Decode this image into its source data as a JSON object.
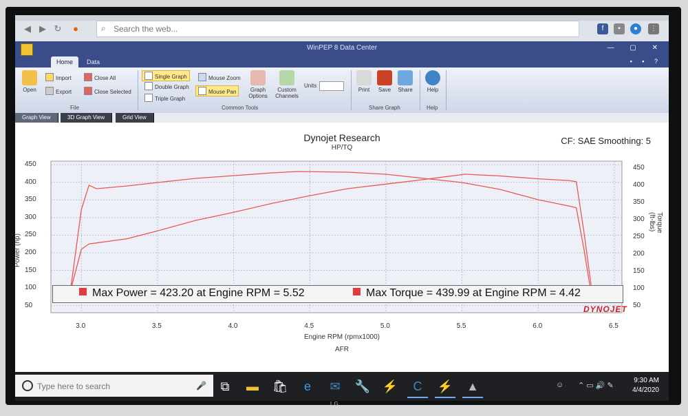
{
  "browser": {
    "search_placeholder": "Search the web..."
  },
  "app": {
    "title": "WinPEP 8 Data Center",
    "tabs": [
      "Home",
      "Data"
    ]
  },
  "ribbon": {
    "open": "Open",
    "import": "Import",
    "export": "Export",
    "close_all": "Close All",
    "close_selected": "Close Selected",
    "file_group": "File",
    "single_graph": "Single Graph",
    "double_graph": "Double Graph",
    "triple_graph": "Triple Graph",
    "mouse_zoom": "Mouse Zoom",
    "mouse_pan": "Mouse Pan",
    "graph_options_1": "Graph",
    "graph_options_2": "Options",
    "custom_channels_1": "Custom",
    "custom_channels_2": "Channels",
    "units": "Units",
    "common_tools_group": "Common Tools",
    "print": "Print",
    "save": "Save",
    "share": "Share",
    "share_graph_group": "Share Graph",
    "help": "Help",
    "help_group": "Help"
  },
  "view_tabs": [
    "Graph View",
    "3D Graph View",
    "Grid View"
  ],
  "graph": {
    "title": "Dynojet Research",
    "subtitle": "HP/TQ",
    "cf": "CF: SAE Smoothing: 5",
    "ylabel_left": "Power (hp)",
    "ylabel_right": "Torque (ft-lbs)",
    "xlabel": "Engine RPM (rpmx1000)",
    "footer": "AFR",
    "brand": "DYNOJET",
    "legend": [
      "Max Power = 423.20 at Engine RPM = 5.52",
      "Max Torque = 439.99 at Engine RPM = 4.42"
    ],
    "left_ticks": [
      "450",
      "400",
      "350",
      "300",
      "250",
      "200",
      "150",
      "100",
      "50"
    ],
    "right_ticks": [
      "450",
      "400",
      "350",
      "300",
      "250",
      "200",
      "150",
      "100",
      "50"
    ],
    "x_ticks": [
      "3.0",
      "3.5",
      "4.0",
      "4.5",
      "5.0",
      "5.5",
      "6.0",
      "6.5"
    ]
  },
  "chart_data": {
    "type": "line",
    "title": "Dynojet Research",
    "subtitle": "HP/TQ",
    "xlabel": "Engine RPM (rpmx1000)",
    "ylabel": "Power (hp)",
    "ylabel_right": "Torque (ft-lbs)",
    "xlim": [
      2.8,
      6.55
    ],
    "ylim": [
      30,
      460
    ],
    "ylim_right": [
      30,
      470
    ],
    "grid": true,
    "color": "#e8584f",
    "series": [
      {
        "name": "Power",
        "axis": "left",
        "x": [
          2.93,
          3.0,
          3.05,
          3.1,
          3.3,
          3.5,
          3.75,
          4.0,
          4.25,
          4.5,
          4.75,
          5.0,
          5.25,
          5.52,
          5.75,
          6.0,
          6.2,
          6.25,
          6.3,
          6.35
        ],
        "values": [
          95,
          210,
          225,
          228,
          240,
          262,
          292,
          315,
          340,
          362,
          382,
          395,
          408,
          423,
          418,
          410,
          405,
          402,
          260,
          100
        ]
      },
      {
        "name": "Torque",
        "axis": "right",
        "x": [
          2.93,
          3.0,
          3.05,
          3.1,
          3.3,
          3.5,
          3.75,
          4.0,
          4.25,
          4.42,
          4.75,
          5.0,
          5.25,
          5.5,
          5.75,
          6.0,
          6.2,
          6.25,
          6.3,
          6.35
        ],
        "values": [
          100,
          330,
          400,
          390,
          398,
          408,
          420,
          428,
          436,
          440,
          438,
          432,
          420,
          408,
          388,
          358,
          340,
          335,
          215,
          80
        ]
      }
    ]
  },
  "taskbar": {
    "search_placeholder": "Type here to search",
    "time": "9:30 AM",
    "date": "4/4/2020"
  },
  "monitor": {
    "brand": "LG"
  },
  "icons": {
    "legend_color": "#e23b3b",
    "accent": "#3a4d8a"
  }
}
